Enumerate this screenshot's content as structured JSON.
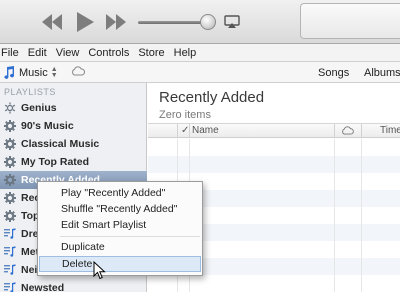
{
  "menubar": [
    "File",
    "Edit",
    "View",
    "Controls",
    "Store",
    "Help"
  ],
  "toolbar": {
    "library": "Music",
    "tabs": [
      "Songs",
      "Albums"
    ]
  },
  "player": {
    "volume_fraction": 0.88
  },
  "sidebar": {
    "header": "PLAYLISTS",
    "items": [
      {
        "label": "Genius",
        "icon": "genius-icon"
      },
      {
        "label": "90's Music",
        "icon": "smart-playlist-gear-icon"
      },
      {
        "label": "Classical Music",
        "icon": "smart-playlist-gear-icon"
      },
      {
        "label": "My Top Rated",
        "icon": "smart-playlist-gear-icon"
      },
      {
        "label": "Recently Added",
        "icon": "smart-playlist-gear-icon",
        "selected": true
      },
      {
        "label": "Rec",
        "icon": "smart-playlist-gear-icon"
      },
      {
        "label": "Top",
        "icon": "smart-playlist-gear-icon"
      },
      {
        "label": "Dre",
        "icon": "playlist-icon"
      },
      {
        "label": "Met",
        "icon": "playlist-icon"
      },
      {
        "label": "Nei",
        "icon": "playlist-icon"
      },
      {
        "label": "Newsted",
        "icon": "playlist-icon"
      }
    ]
  },
  "main": {
    "title": "Recently Added",
    "subtitle": "Zero items",
    "columns": {
      "check": "✓",
      "name": "Name",
      "time": "Time"
    }
  },
  "context_menu": {
    "items": [
      "Play \"Recently Added\"",
      "Shuffle \"Recently Added\"",
      "Edit Smart Playlist",
      "Duplicate",
      "Delete"
    ],
    "hovered": "Delete"
  },
  "colors": {
    "selection": "#8da2bf",
    "menu_hover": "#dde9f7"
  }
}
